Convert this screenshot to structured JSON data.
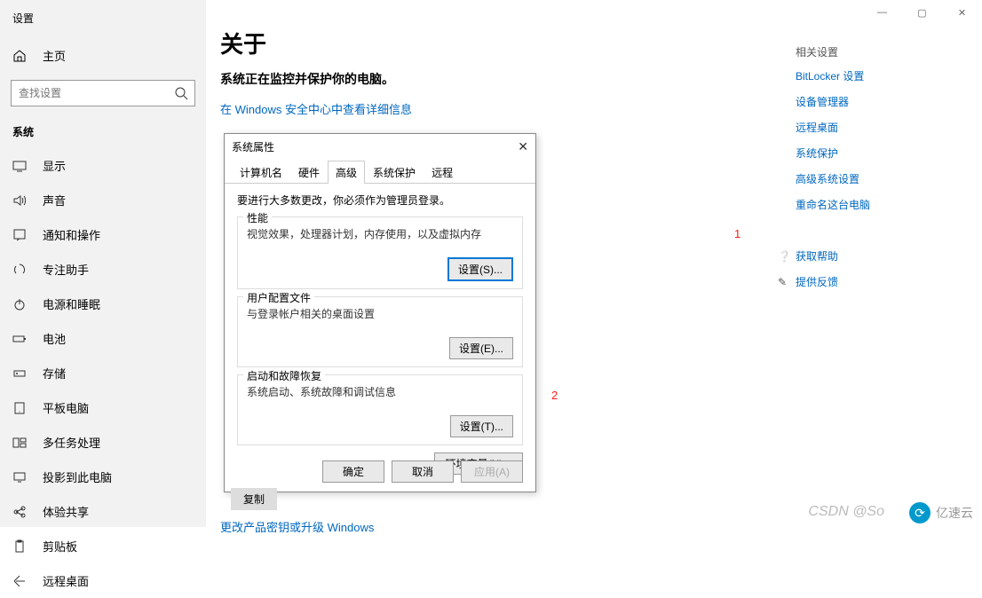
{
  "window": {
    "title": "设置",
    "minimize": "—",
    "maximize": "▢",
    "close": "✕"
  },
  "sidebar": {
    "home": "主页",
    "search_placeholder": "查找设置",
    "category": "系统",
    "items": [
      {
        "label": "显示"
      },
      {
        "label": "声音"
      },
      {
        "label": "通知和操作"
      },
      {
        "label": "专注助手"
      },
      {
        "label": "电源和睡眠"
      },
      {
        "label": "电池"
      },
      {
        "label": "存储"
      },
      {
        "label": "平板电脑"
      },
      {
        "label": "多任务处理"
      },
      {
        "label": "投影到此电脑"
      },
      {
        "label": "体验共享"
      },
      {
        "label": "剪贴板"
      },
      {
        "label": "远程桌面"
      }
    ]
  },
  "main": {
    "title": "关于",
    "subtitle": "系统正在监控并保护你的电脑。",
    "security_link": "在 Windows 安全中心中查看详细信息",
    "copy_btn": "复制",
    "upgrade_link": "更改产品密钥或升级 Windows"
  },
  "related": {
    "heading": "相关设置",
    "links": [
      "BitLocker 设置",
      "设备管理器",
      "远程桌面",
      "系统保护",
      "高级系统设置",
      "重命名这台电脑"
    ]
  },
  "help": {
    "get_help": "获取帮助",
    "feedback": "提供反馈"
  },
  "dialog": {
    "title": "系统属性",
    "tabs": [
      "计算机名",
      "硬件",
      "高级",
      "系统保护",
      "远程"
    ],
    "active_tab": 2,
    "notice": "要进行大多数更改，你必须作为管理员登录。",
    "groups": [
      {
        "title": "性能",
        "desc": "视觉效果，处理器计划，内存使用，以及虚拟内存",
        "btn": "设置(S)..."
      },
      {
        "title": "用户配置文件",
        "desc": "与登录帐户相关的桌面设置",
        "btn": "设置(E)..."
      },
      {
        "title": "启动和故障恢复",
        "desc": "系统启动、系统故障和调试信息",
        "btn": "设置(T)..."
      }
    ],
    "env_btn": "环境变量(N)...",
    "ok": "确定",
    "cancel": "取消",
    "apply": "应用(A)"
  },
  "annotations": {
    "a1": "1",
    "a2": "2"
  },
  "watermark": {
    "csdn": "CSDN @So",
    "brand": "亿速云"
  }
}
